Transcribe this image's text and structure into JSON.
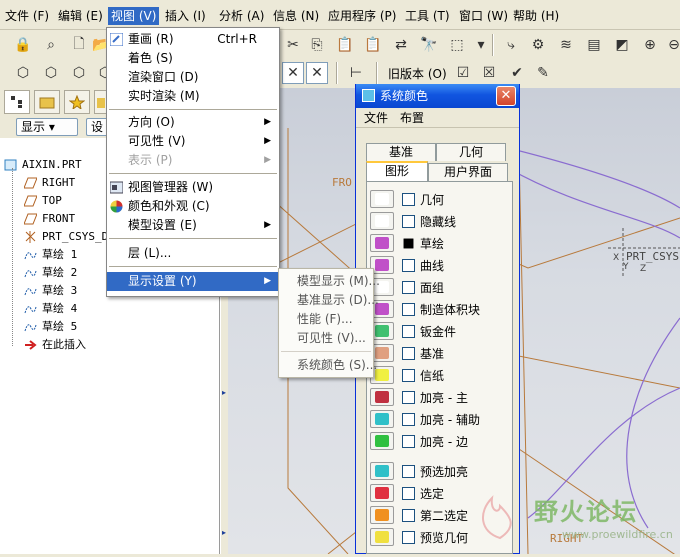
{
  "menubar": {
    "items": [
      "文件 (F)",
      "编辑 (E)",
      "视图 (V)",
      "插入 (I)",
      "分析 (A)",
      "信息 (N)",
      "应用程序 (P)",
      "工具 (T)",
      "窗口 (W)",
      "帮助 (H)"
    ]
  },
  "toolbar": {
    "version_label": "旧版本 (O)"
  },
  "tree": {
    "display_btn": "显示 ▾",
    "settings_btn": "设",
    "items": [
      "AIXIN.PRT",
      "RIGHT",
      "TOP",
      "FRONT",
      "PRT_CSYS_DE",
      "草绘 1",
      "草绘 2",
      "草绘 3",
      "草绘 4",
      "草绘 5",
      "在此插入"
    ]
  },
  "view_menu": {
    "items": [
      {
        "label": "重画 (R)",
        "accel": "Ctrl+R"
      },
      {
        "label": "着色 (S)"
      },
      {
        "label": "渲染窗口 (D)"
      },
      {
        "label": "实时渲染 (M)"
      },
      {
        "label": "方向 (O)"
      },
      {
        "label": "可见性 (V)"
      },
      {
        "label": "表示 (P)"
      },
      {
        "label": "视图管理器 (W)"
      },
      {
        "label": "颜色和外观 (C)"
      },
      {
        "label": "模型设置 (E)"
      },
      {
        "label": "层 (L)..."
      },
      {
        "label": "显示设置 (Y)"
      }
    ]
  },
  "display_submenu": {
    "items": [
      "模型显示 (M)...",
      "基准显示 (D)...",
      "性能 (F)...",
      "可见性 (V)...",
      "系统颜色 (S)..."
    ]
  },
  "graphics": {
    "labels": [
      "FRO",
      "PRT_CSYS",
      "X",
      "Y",
      "Z",
      "RIGHT"
    ]
  },
  "dialog": {
    "title": "系统颜色",
    "close_glyph": "✕",
    "menu": [
      "文件",
      "布置"
    ],
    "tabs_row1": [
      "基准",
      "几何"
    ],
    "tabs_row2": [
      "图形",
      "用户界面"
    ],
    "rows": [
      {
        "label": "几何",
        "color": "#ffffff",
        "checked": false
      },
      {
        "label": "隐藏线",
        "color": "#ffffff",
        "checked": false
      },
      {
        "label": "草绘",
        "color": "#c050c8",
        "checked": true
      },
      {
        "label": "曲线",
        "color": "#c050c8",
        "checked": false
      },
      {
        "label": "面组",
        "color": "#ffffff",
        "checked": false
      },
      {
        "label": "制造体积块",
        "color": "#c050c8",
        "checked": false
      },
      {
        "label": "钣金件",
        "color": "#40c070",
        "checked": false
      },
      {
        "label": "基准",
        "color": "#e0a080",
        "checked": false
      },
      {
        "label": "信纸",
        "color": "#f0f040",
        "checked": false
      },
      {
        "label": "加亮 - 主",
        "color": "#c03040",
        "checked": false
      },
      {
        "label": "加亮 - 辅助",
        "color": "#30c0c8",
        "checked": false
      },
      {
        "label": "加亮 - 边",
        "color": "#30c040",
        "checked": false
      },
      {
        "label": "预选加亮",
        "color": "#30c0c8",
        "checked": false
      },
      {
        "label": "选定",
        "color": "#e03040",
        "checked": false
      },
      {
        "label": "第二选定",
        "color": "#f09020",
        "checked": false
      },
      {
        "label": "预览几何",
        "color": "#f0e040",
        "checked": false
      }
    ]
  },
  "watermark": {
    "title": "野火论坛",
    "url": "www.proewildfire.cn"
  },
  "colors": {
    "selection": "#316ac5",
    "title_bar": "#0a47d1",
    "wire": "#b87a3c",
    "curve": "#8a6cd0"
  }
}
